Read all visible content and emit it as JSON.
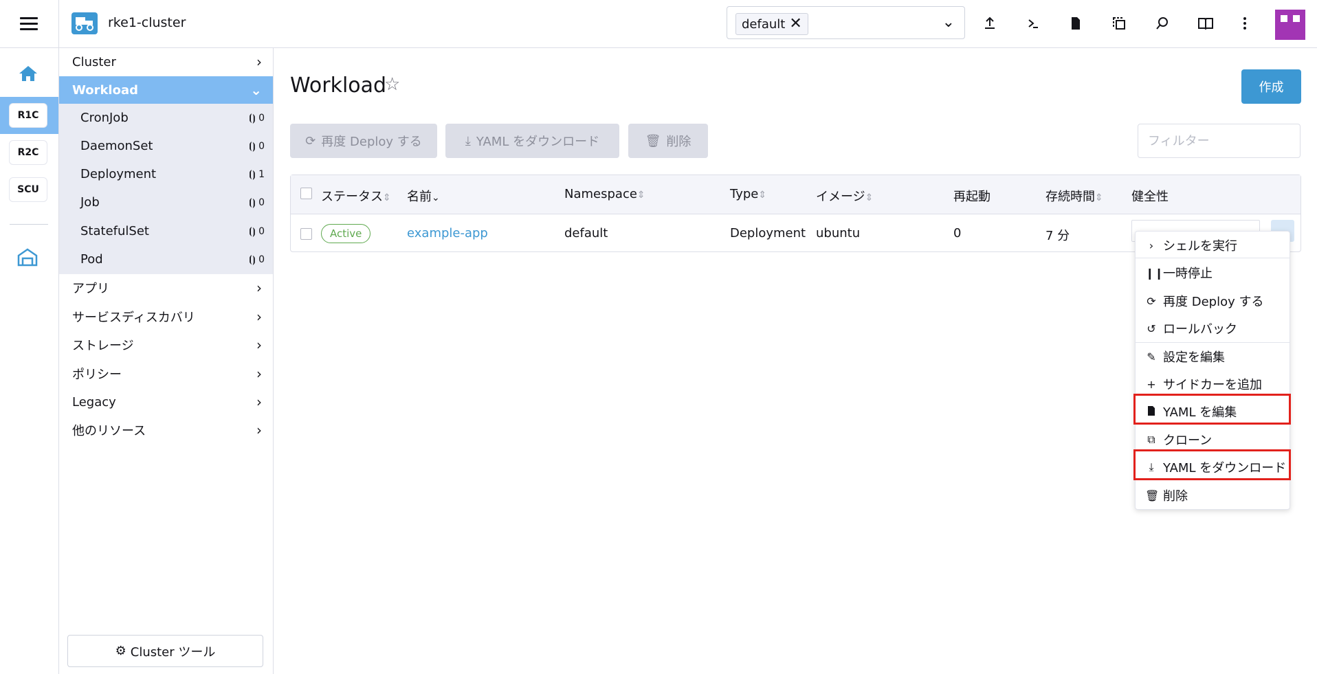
{
  "header": {
    "cluster_name": "rke1-cluster",
    "namespace_chip": "default",
    "chip_remove": "✕",
    "icons": [
      "upload-icon",
      "shell-icon",
      "file-icon",
      "copy-icon",
      "search-icon",
      "book-icon",
      "more-icon"
    ]
  },
  "rail": {
    "items": [
      "R1C",
      "R2C",
      "SCU"
    ]
  },
  "sidenav": {
    "cluster": "Cluster",
    "workload": "Workload",
    "sub": [
      {
        "label": "CronJob",
        "count": "0"
      },
      {
        "label": "DaemonSet",
        "count": "0"
      },
      {
        "label": "Deployment",
        "count": "1"
      },
      {
        "label": "Job",
        "count": "0"
      },
      {
        "label": "StatefulSet",
        "count": "0"
      },
      {
        "label": "Pod",
        "count": "0"
      }
    ],
    "groups": [
      "アプリ",
      "サービスディスカバリ",
      "ストレージ",
      "ポリシー",
      "Legacy",
      "他のリソース"
    ],
    "cluster_tools": "Cluster ツール"
  },
  "main": {
    "title": "Workload",
    "create": "作成",
    "redeploy": "再度 Deploy する",
    "download_yaml": "YAML をダウンロード",
    "delete": "削除",
    "filter_placeholder": "フィルター"
  },
  "table": {
    "headers": {
      "status": "ステータス",
      "name": "名前",
      "namespace": "Namespace",
      "type": "Type",
      "image": "イメージ",
      "restarts": "再起動",
      "age": "存続時間",
      "health": "健全性"
    },
    "row": {
      "status": "Active",
      "name": "example-app",
      "namespace": "default",
      "type": "Deployment",
      "image": "ubuntu",
      "restarts": "0",
      "age": "7 分"
    }
  },
  "menu": {
    "items": [
      "シェルを実行",
      "一時停止",
      "再度 Deploy する",
      "ロールバック",
      "設定を編集",
      "サイドカーを追加",
      "YAML を編集",
      "クローン",
      "YAML をダウンロード",
      "削除"
    ]
  },
  "colors": {
    "accent": "#3d98d3",
    "active_nav": "#7fbaf2",
    "highlight": "#e2211c",
    "badge_green": "#5fa94f"
  }
}
